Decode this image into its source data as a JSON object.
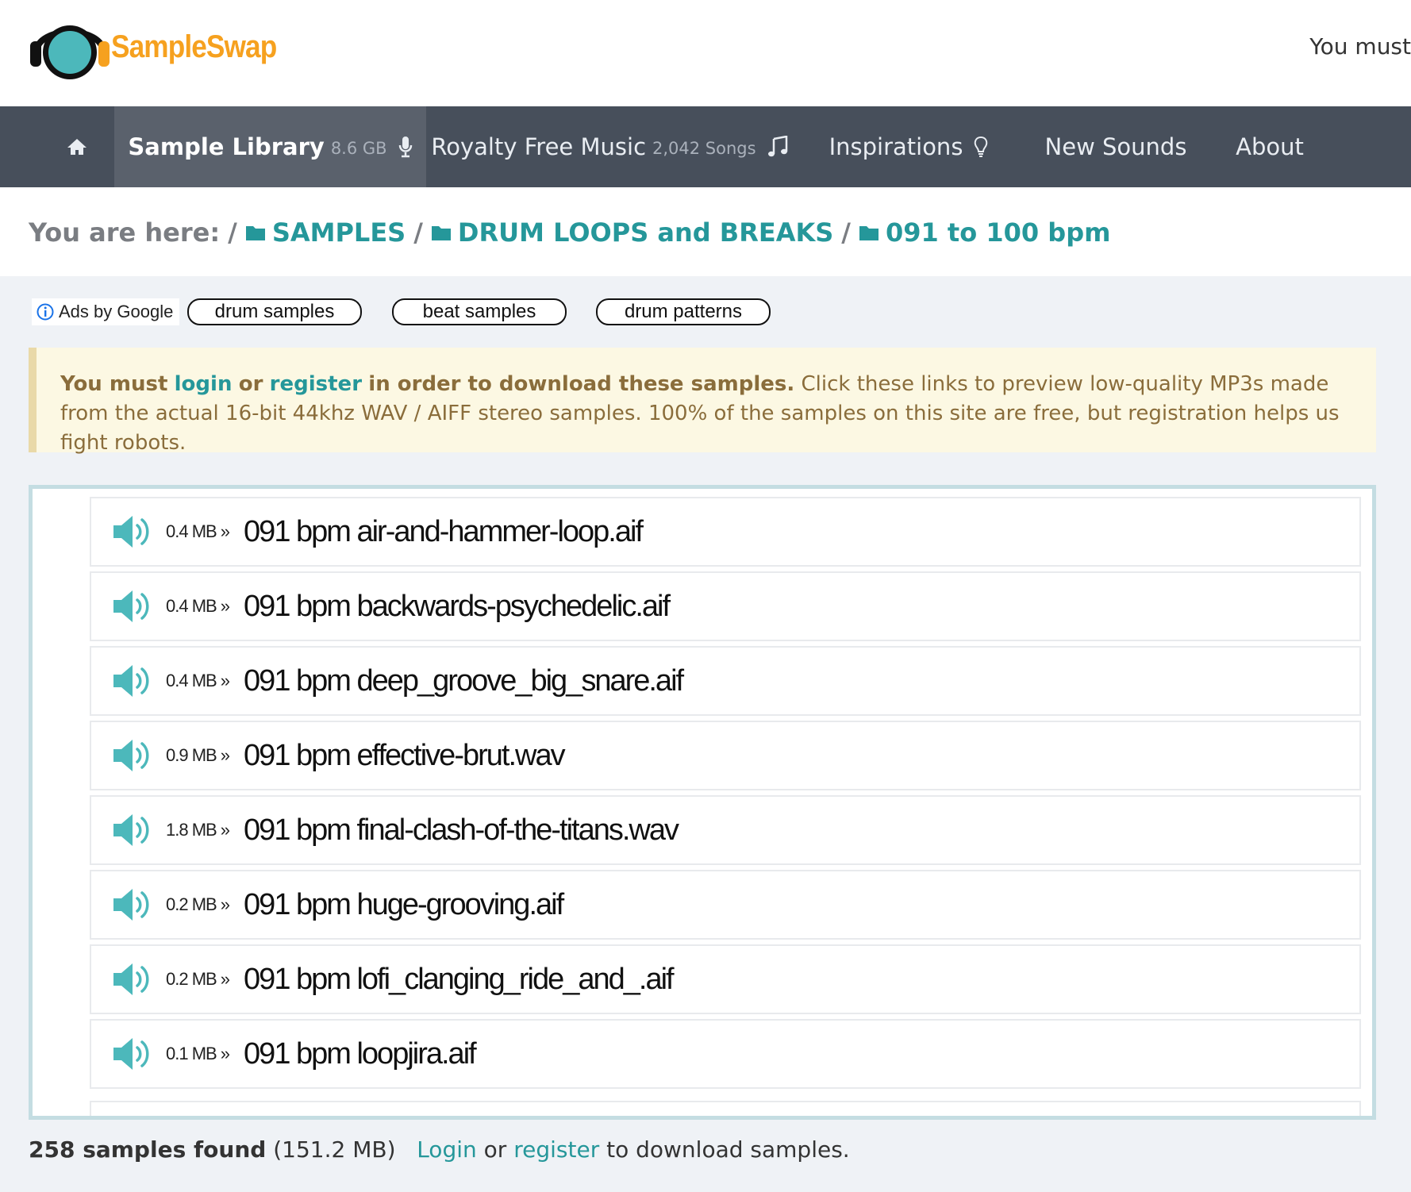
{
  "brand": {
    "logo_text": "SampleSwap",
    "logo_icon": "headphones-logo-icon",
    "colors": {
      "orange": "#f6a11f",
      "teal": "#4cb8bb",
      "nav": "#474f5b",
      "link": "#25979a"
    }
  },
  "header": {
    "top_right_text": "You must"
  },
  "nav": {
    "home_icon": "home-icon",
    "items": [
      {
        "label": "Sample Library",
        "sub": "8.6 GB",
        "icon": "microphone-icon",
        "active": true
      },
      {
        "label": "Royalty Free Music",
        "sub": "2,042 Songs",
        "icon": "music-note-icon",
        "active": false
      },
      {
        "label": "Inspirations",
        "sub": "",
        "icon": "lightbulb-icon",
        "active": false
      },
      {
        "label": "New Sounds",
        "sub": "",
        "icon": "",
        "active": false
      },
      {
        "label": "About",
        "sub": "",
        "icon": "",
        "active": false
      }
    ]
  },
  "breadcrumb": {
    "prefix": "You are here:",
    "sep": "/",
    "items": [
      "SAMPLES",
      "DRUM LOOPS and BREAKS",
      "091 to 100 bpm"
    ]
  },
  "ads": {
    "label": "Ads by Google",
    "pills": [
      "drum samples",
      "beat samples",
      "drum patterns"
    ]
  },
  "alert": {
    "bold_1": "You must",
    "login": "login",
    "or": "or",
    "register": "register",
    "bold_2": "in order to download these samples.",
    "text": "Click these links to preview low-quality MP3s made from the actual 16-bit 44khz WAV / AIFF stereo samples. 100% of the samples on this site are free, but registration helps us fight robots."
  },
  "samples": [
    {
      "size": "0.4 MB »",
      "name": "091 bpm air-and-hammer-loop.aif"
    },
    {
      "size": "0.4 MB »",
      "name": "091 bpm backwards-psychedelic.aif"
    },
    {
      "size": "0.4 MB »",
      "name": "091 bpm deep_groove_big_snare.aif"
    },
    {
      "size": "0.9 MB »",
      "name": "091 bpm effective-brut.wav"
    },
    {
      "size": "1.8 MB »",
      "name": "091 bpm final-clash-of-the-titans.wav"
    },
    {
      "size": "0.2 MB »",
      "name": "091 bpm huge-grooving.aif"
    },
    {
      "size": "0.2 MB »",
      "name": "091 bpm lofi_clanging_ride_and_.aif"
    },
    {
      "size": "0.1 MB »",
      "name": "091 bpm loopjira.aif"
    }
  ],
  "footer": {
    "count": "258 samples found",
    "total": "(151.2 MB)",
    "login": "Login",
    "or": "or",
    "register": "register",
    "tail": "to download samples."
  }
}
